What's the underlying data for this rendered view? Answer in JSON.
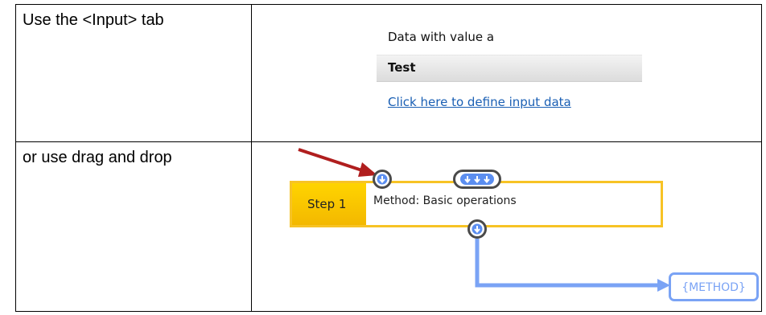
{
  "rows": [
    {
      "instruction": "Use the <Input> tab",
      "panel": {
        "heading": "Data with value a",
        "bar_label": "Test",
        "link_text": "Click here to define input data"
      }
    },
    {
      "instruction": "or use drag and drop",
      "diagram": {
        "step_label": "Step 1",
        "method_text": "Method: Basic operations",
        "output_chip": "{METHOD}"
      }
    }
  ],
  "colors": {
    "step_border": "#f7c325",
    "step_fill": "#ffd400",
    "connector": "#7aa3f5",
    "arrow": "#b01e1e",
    "port_arrow": "#5b8ef0"
  }
}
